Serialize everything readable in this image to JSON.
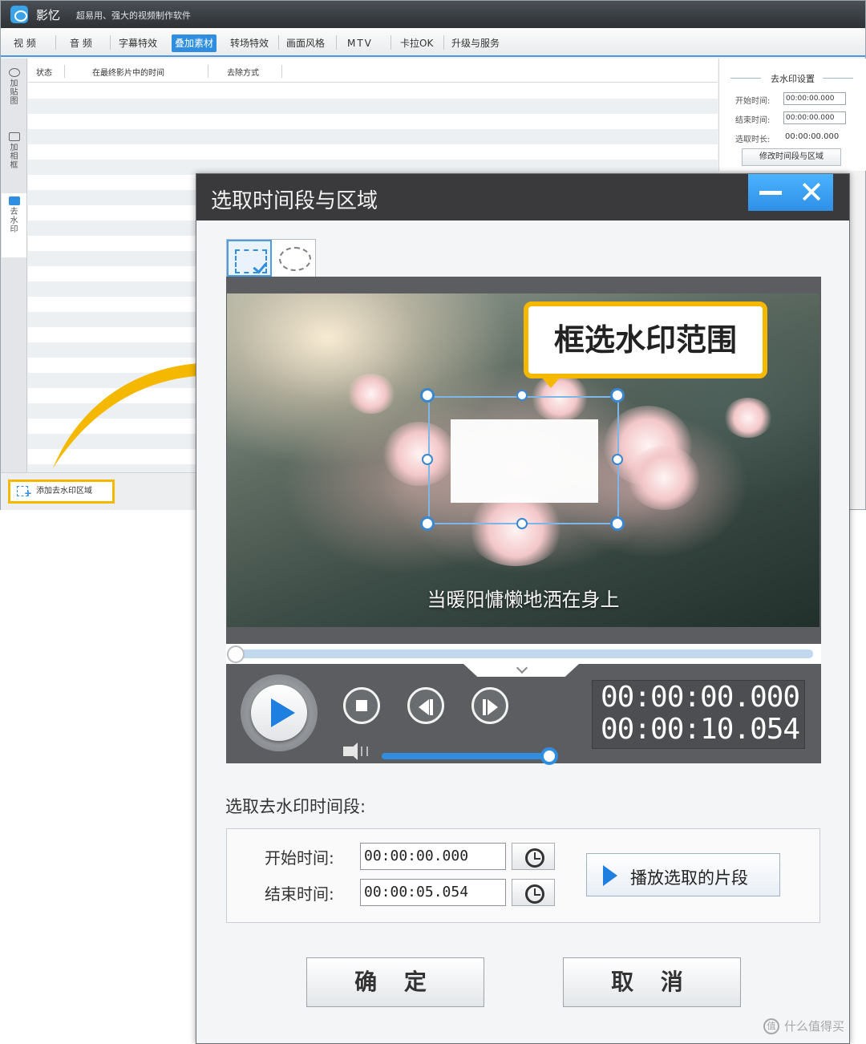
{
  "app": {
    "name": "影忆",
    "tagline": "超易用、强大的视频制作软件",
    "menu": [
      "视 频",
      "音 频",
      "字幕特效",
      "叠加素材",
      "转场特效",
      "画面风格",
      "MTV",
      "卡拉OK",
      "升级与服务"
    ],
    "active_menu": "叠加素材"
  },
  "sidebar": {
    "tabs": [
      {
        "label": "加贴图",
        "icon": "sticker-icon"
      },
      {
        "label": "加相框",
        "icon": "frame-icon"
      },
      {
        "label": "去水印",
        "icon": "watermark-icon"
      }
    ]
  },
  "table": {
    "columns": [
      "状态",
      "在最终影片中的时间",
      "去除方式"
    ]
  },
  "right_panel": {
    "title": "去水印设置",
    "start_label": "开始时间:",
    "start_value": "00:00:00.000",
    "end_label": "结束时间:",
    "end_value": "00:00:00.000",
    "duration_label": "选取时长:",
    "duration_value": "00:00:00.000",
    "button": "修改时间段与区域"
  },
  "bottom": {
    "add_area_button": "添加去水印区域"
  },
  "dialog": {
    "title": "选取时间段与区域",
    "callout": "框选水印范围",
    "subtitle": "当暖阳慵懒地洒在身上",
    "time_current": "00:00:00.000",
    "time_total": "00:00:10.054",
    "segment_heading": "选取去水印时间段:",
    "start_label": "开始时间:",
    "start_value": "00:00:00.000",
    "end_label": "结束时间:",
    "end_value": "00:00:05.054",
    "play_segment_button": "播放选取的片段",
    "ok_button": "确 定",
    "cancel_button": "取 消",
    "playback_progress": 0.0,
    "volume_level": 1.0
  },
  "site_watermark": {
    "icon": "值",
    "text": "什么值得买"
  },
  "colors": {
    "accent": "#2f8ee0",
    "highlight": "#f5b800",
    "dialog_titlebar": "#3a3a3c"
  }
}
